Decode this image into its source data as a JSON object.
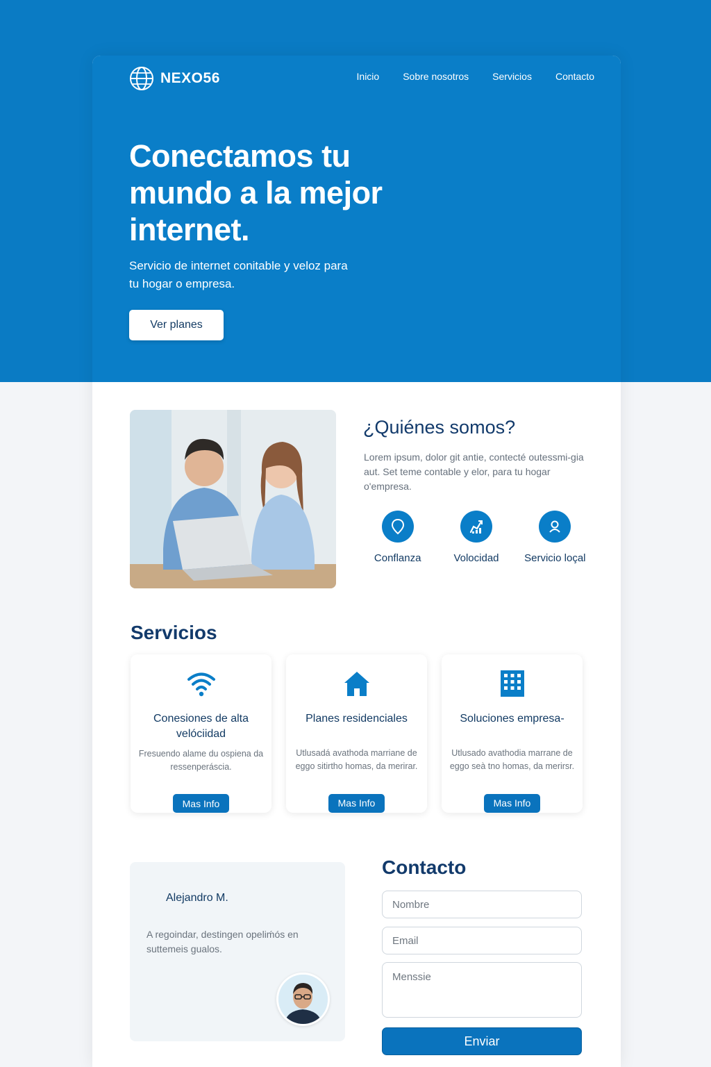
{
  "brand": {
    "name": "NEXO56",
    "icon": "globe-icon"
  },
  "nav": {
    "items": [
      "Inicio",
      "Sobre nosotros",
      "Servicios",
      "Contacto"
    ]
  },
  "hero": {
    "title": "Conectamos tu mundo a la mejor internet.",
    "subtitle": "Servicio de internet conitable y veloz para tu hogar o empresa.",
    "cta_label": "Ver planes"
  },
  "about": {
    "title": "¿Quiénes somos?",
    "text": "Lorem ipsum, dolor git antie, contecté outessmi-gia aut. Set teme contable y elor, para tu hogar o'empresa.",
    "features": [
      {
        "label": "Conflanza",
        "icon": "map-pin-icon"
      },
      {
        "label": "Volocidad",
        "icon": "speed-icon"
      },
      {
        "label": "Servicio loçal",
        "icon": "user-icon"
      }
    ]
  },
  "services": {
    "title": "Servicios",
    "items": [
      {
        "title": "Conesiones de alta velóciidad",
        "desc": "Fresuendo alame du ospiena da ressenperáscia.",
        "button": "Mas Info",
        "icon": "wifi-icon"
      },
      {
        "title": "Planes residenciales",
        "desc": "Utlusadá avathoda marriane de eggo sitirtho homas, da merirar.",
        "button": "Mas Info",
        "icon": "home-icon"
      },
      {
        "title": "Soluciones empresa-",
        "desc": "Utlusado avathodia marrane de eggo seà tno homas, da merirsr.",
        "button": "Mas Info",
        "icon": "building-icon"
      }
    ]
  },
  "testimonial": {
    "name": "Alejandro M.",
    "text": "A regoindar, destingen opeliḿós en suttemeis gualos."
  },
  "contact": {
    "title": "Contacto",
    "name_placeholder": "Nombre",
    "email_placeholder": "Email",
    "message_placeholder": "Menssie",
    "submit_label": "Enviar"
  },
  "colors": {
    "primary": "#0a7ec8",
    "heading": "#123a6b",
    "button": "#0a73bd"
  }
}
